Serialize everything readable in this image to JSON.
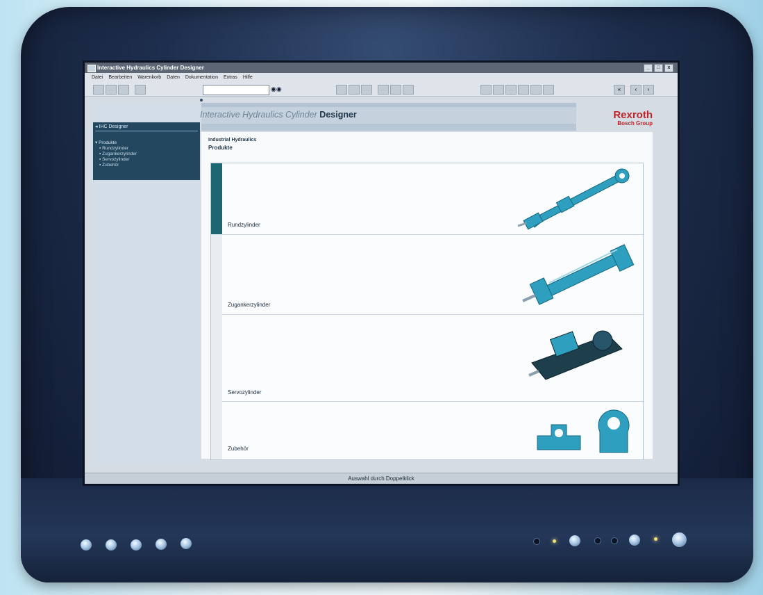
{
  "window": {
    "title": "Interactive Hydraulics Cylinder Designer",
    "controls": [
      "_",
      "□",
      "x"
    ]
  },
  "menu": [
    "Datei",
    "Bearbeiten",
    "Warenkorb",
    "Daten",
    "Dokumentation",
    "Extras",
    "Hilfe"
  ],
  "toolbar": {
    "search_value": "",
    "nav_first": "«",
    "nav_prev": "‹",
    "nav_next": "›"
  },
  "header": {
    "title_prefix": "Interactive Hydraulics Cylinder",
    "title_strong": "Designer"
  },
  "logo": {
    "brand": "Rexroth",
    "group": "Bosch Group"
  },
  "sidebar": {
    "head": "IHC Designer",
    "section": "Produkte",
    "items": [
      "Rundzylinder",
      "Zugankerzylinder",
      "Servozylinder",
      "Zubehör"
    ]
  },
  "content": {
    "breadcrumb_top": "Industrial Hydraulics",
    "breadcrumb_title": "Produkte",
    "products": [
      {
        "label": "Rundzylinder",
        "selected": true
      },
      {
        "label": "Zugankerzylinder",
        "selected": false
      },
      {
        "label": "Servozylinder",
        "selected": false
      },
      {
        "label": "Zubehör",
        "selected": false
      }
    ]
  },
  "status": "Auswahl durch Doppelklick",
  "colors": {
    "accent": "#1f6673",
    "brand": "#c0242a",
    "sidebar": "#22475f",
    "product": "#2e9fbf"
  }
}
